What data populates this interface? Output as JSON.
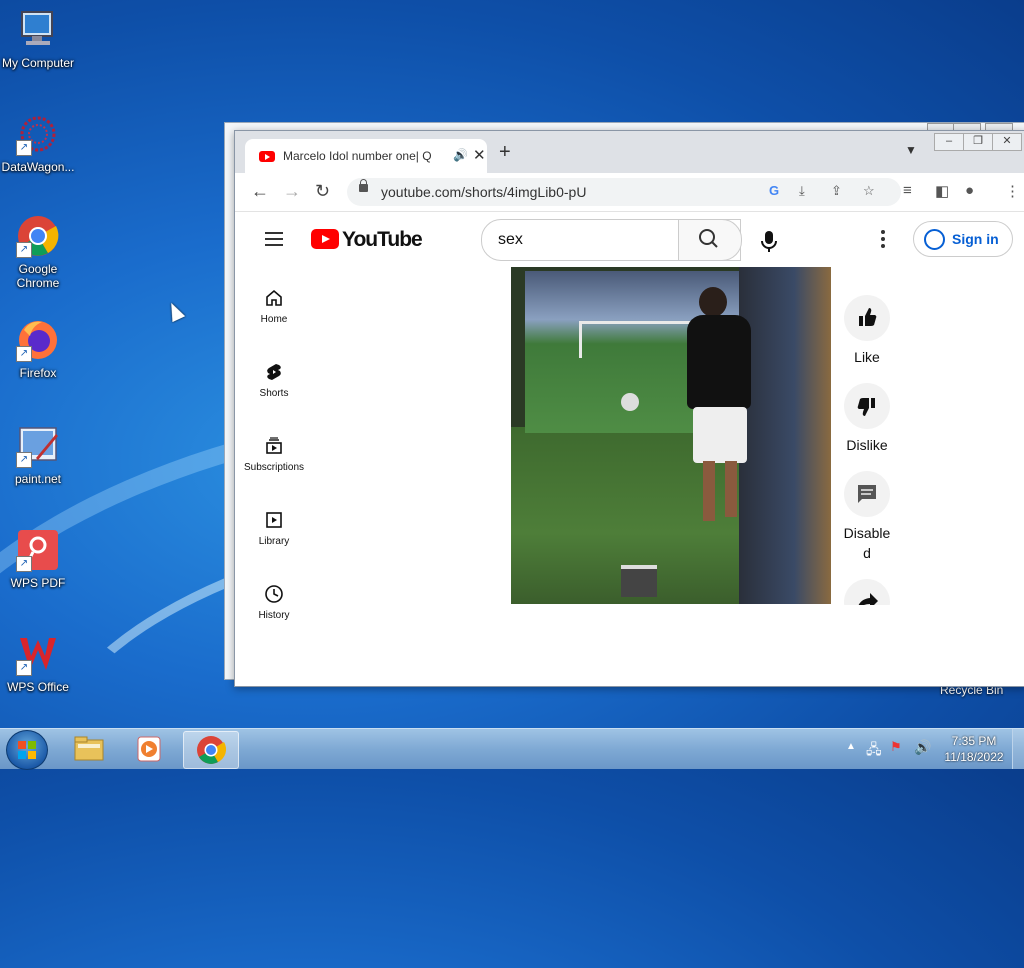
{
  "desktop": {
    "icons": [
      {
        "label": "My Computer"
      },
      {
        "label": "DataWagon..."
      },
      {
        "label": "Google Chrome"
      },
      {
        "label": "Firefox"
      },
      {
        "label": "paint.net"
      },
      {
        "label": "WPS PDF"
      },
      {
        "label": "WPS Office"
      }
    ],
    "recycle_bin_label": "Recycle Bin"
  },
  "browser": {
    "tab": {
      "title": "Marcelo Idol number one| Q",
      "audio_icon": "speaker-icon",
      "close_label": "✕"
    },
    "new_tab_label": "+",
    "address": {
      "url": "youtube.com/shorts/4imgLib0-pU"
    },
    "window_controls": [
      "min",
      "max",
      "close"
    ]
  },
  "youtube": {
    "logo_text": "YouTube",
    "search": {
      "value": "sex"
    },
    "sign_in_label": "Sign in",
    "guide": [
      {
        "label": "Home",
        "icon": "home-icon"
      },
      {
        "label": "Shorts",
        "icon": "shorts-icon"
      },
      {
        "label": "Subscriptions",
        "icon": "subscriptions-icon"
      },
      {
        "label": "Library",
        "icon": "library-icon"
      },
      {
        "label": "History",
        "icon": "history-icon"
      }
    ],
    "actions": [
      {
        "label": "Like",
        "icon": "thumbs-up-icon"
      },
      {
        "label": "Dislike",
        "icon": "thumbs-down-icon"
      },
      {
        "label": "Disable\nd",
        "icon": "comment-icon"
      },
      {
        "label": "",
        "icon": "share-icon"
      }
    ]
  },
  "taskbar": {
    "time": "7:35 PM",
    "date": "11/18/2022"
  },
  "colors": {
    "youtube_red": "#ff0000",
    "link_blue": "#065fd4",
    "desktop_blue": "#1a6ccc"
  }
}
